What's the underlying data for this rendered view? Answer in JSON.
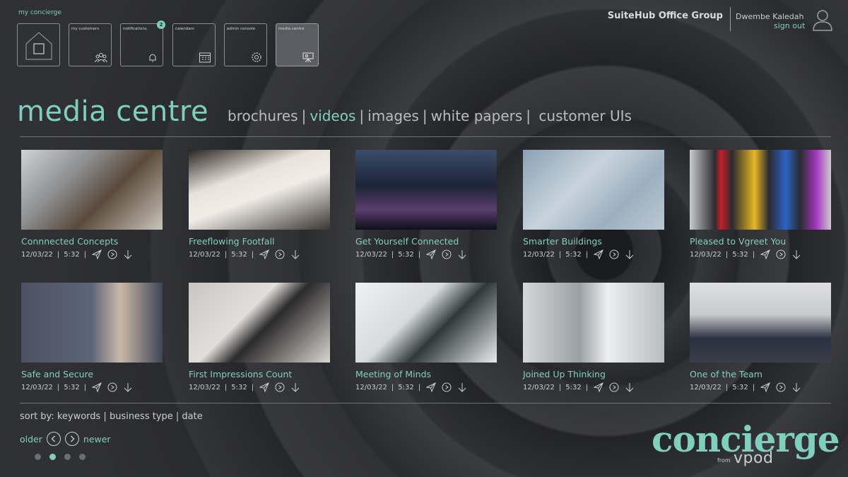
{
  "app": {
    "brand_small": "my concierge"
  },
  "tiles": [
    {
      "label": "",
      "icon": "home-icon"
    },
    {
      "label": "my customers",
      "icon": "people-icon"
    },
    {
      "label": "notifications",
      "icon": "bell-icon",
      "badge": "2"
    },
    {
      "label": "calendars",
      "icon": "calendar-icon"
    },
    {
      "label": "admin console",
      "icon": "gear-icon"
    },
    {
      "label": "media centre",
      "icon": "projector-icon",
      "active": true
    }
  ],
  "header": {
    "org": "SuiteHub Office Group",
    "user": "Dwembe Kaledah",
    "sign_out": "sign out"
  },
  "page": {
    "title": "media centre",
    "tabs": [
      {
        "label": "brochures",
        "selected": false
      },
      {
        "label": "videos",
        "selected": true
      },
      {
        "label": "images",
        "selected": false
      },
      {
        "label": "white papers",
        "selected": false
      },
      {
        "label": "customer UIs",
        "selected": false
      }
    ]
  },
  "media": [
    {
      "title": "Connnected Concepts",
      "date": "12/03/22",
      "duration": "5:32"
    },
    {
      "title": "Freeflowing Footfall",
      "date": "12/03/22",
      "duration": "5:32"
    },
    {
      "title": "Get Yourself Connected",
      "date": "12/03/22",
      "duration": "5:32"
    },
    {
      "title": "Smarter Buildings",
      "date": "12/03/22",
      "duration": "5:32"
    },
    {
      "title": "Pleased to Vgreet You",
      "date": "12/03/22",
      "duration": "5:32"
    },
    {
      "title": "Safe and Secure",
      "date": "12/03/22",
      "duration": "5:32"
    },
    {
      "title": "First Impressions Count",
      "date": "12/03/22",
      "duration": "5:32"
    },
    {
      "title": "Meeting of Minds",
      "date": "12/03/22",
      "duration": "5:32"
    },
    {
      "title": "Joined Up Thinking",
      "date": "12/03/22",
      "duration": "5:32"
    },
    {
      "title": "One of the Team",
      "date": "12/03/22",
      "duration": "5:32"
    }
  ],
  "sort": {
    "text": "sort by: keywords | business type | date"
  },
  "pager": {
    "older": "older",
    "newer": "newer",
    "page_count": 4,
    "current": 2
  },
  "logo": {
    "word": "concierge",
    "from": "from",
    "vpod": "vpod"
  },
  "colors": {
    "accent": "#7fcfc0",
    "background": "#2e2f33"
  }
}
